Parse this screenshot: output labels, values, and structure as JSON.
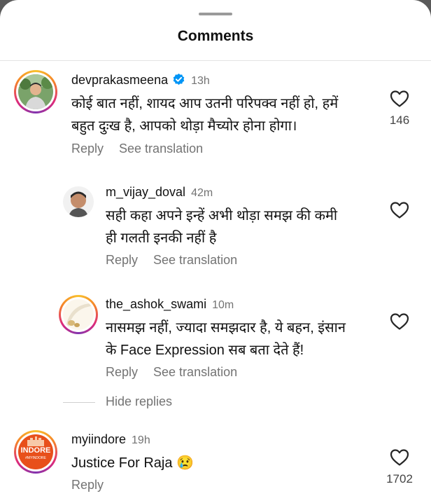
{
  "header": {
    "title": "Comments"
  },
  "comments": [
    {
      "username": "devprakasmeena",
      "verified": true,
      "time": "13h",
      "text": "कोई बात नहीं, शायद आप उतनी  परिपक्व नहीं हो, हमें\nबहुत दुःख है, आपको थोड़ा मैच्योर होना होगा।",
      "reply_label": "Reply",
      "translate_label": "See translation",
      "likes": "146"
    },
    {
      "username": "m_vijay_doval",
      "time": "42m",
      "text": "सही कहा अपने इन्हें अभी थोड़ा समझ की कमी\nही गलती इनकी नहीं है",
      "reply_label": "Reply",
      "translate_label": "See translation"
    },
    {
      "username": "the_ashok_swami",
      "time": "10m",
      "text": "नासमझ नहीं, ज्यादा समझदार है, ये बहन, इंसान\nके Face Expression सब बता देते हैं!",
      "reply_label": "Reply",
      "translate_label": "See translation"
    },
    {
      "username": "myiindore",
      "time": "19h",
      "text": "Justice For Raja 😢",
      "reply_label": "Reply",
      "likes": "1702",
      "avatar_text": "INDORE",
      "avatar_subtext": "#MYINDORE"
    }
  ],
  "hide_replies_label": "Hide replies",
  "colors": {
    "accent_verified": "#0095f6",
    "secondary_text": "#737373",
    "indore_orange": "#e8501b"
  }
}
